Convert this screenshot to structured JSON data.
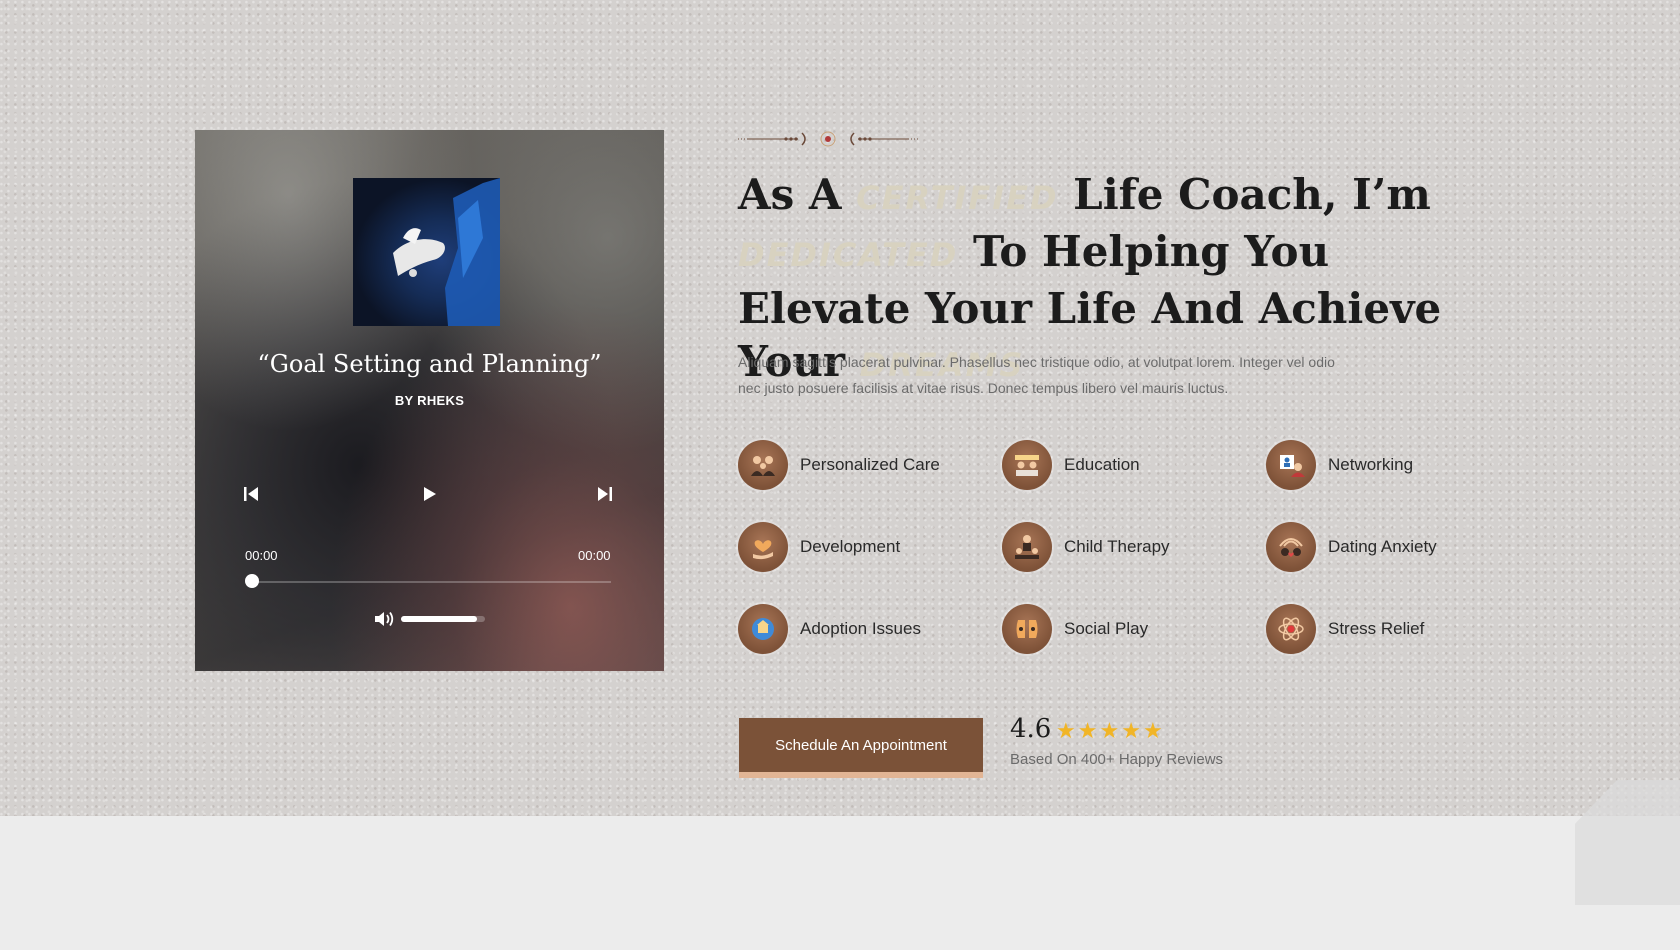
{
  "player": {
    "song_title": "“Goal Setting and Planning”",
    "artist": "BY RHEKS",
    "current_time": "00:00",
    "total_time": "00:00",
    "progress": 0,
    "volume": 0.9
  },
  "headline": {
    "part1": "As A ",
    "accent1": "Certified",
    "part2": " Life Coach, I’m ",
    "accent2": "Dedicated",
    "part3": " To Helping You Elevate Your Life And Achieve Your ",
    "accent3": "Dreams"
  },
  "description": "Aliquam sagittis placerat pulvinar. Phasellus nec tristique odio, at volutpat lorem. Integer vel odio nec justo posuere facilisis at vitae risus. Donec tempus libero vel mauris luctus.",
  "features": [
    {
      "label": "Personalized Care",
      "icon": "family-icon"
    },
    {
      "label": "Education",
      "icon": "students-icon"
    },
    {
      "label": "Networking",
      "icon": "networking-icon"
    },
    {
      "label": "Development",
      "icon": "heart-hand-icon"
    },
    {
      "label": "Child Therapy",
      "icon": "child-therapy-icon"
    },
    {
      "label": "Dating Anxiety",
      "icon": "dating-anxiety-icon"
    },
    {
      "label": "Adoption Issues",
      "icon": "adoption-icon"
    },
    {
      "label": "Social Play",
      "icon": "social-play-icon"
    },
    {
      "label": "Stress Relief",
      "icon": "stress-relief-icon"
    }
  ],
  "cta": {
    "label": "Schedule An Appointment"
  },
  "rating": {
    "value": "4.6",
    "stars": 5,
    "caption": "Based On 400+ Happy Reviews"
  },
  "colors": {
    "accent_brown": "#7b5238",
    "button_shadow": "#e2b595",
    "star": "#f1b527",
    "accent_text": "#d8d2c0"
  }
}
